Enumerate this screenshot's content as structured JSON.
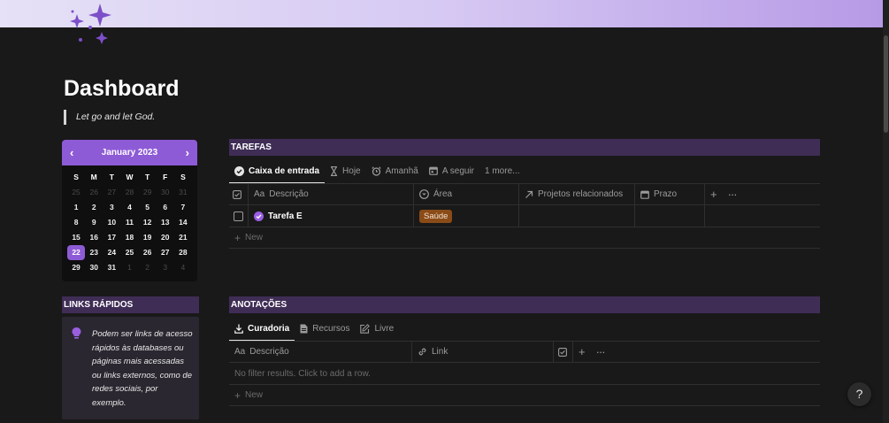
{
  "page": {
    "title": "Dashboard",
    "quote": "Let go and let God."
  },
  "calendar": {
    "month": "January 2023",
    "prev": "‹",
    "next": "›",
    "weekdays": [
      "S",
      "M",
      "T",
      "W",
      "T",
      "F",
      "S"
    ],
    "days": [
      [
        "25",
        "26",
        "27",
        "28",
        "29",
        "30",
        "31"
      ],
      [
        "1",
        "2",
        "3",
        "4",
        "5",
        "6",
        "7"
      ],
      [
        "8",
        "9",
        "10",
        "11",
        "12",
        "13",
        "14"
      ],
      [
        "15",
        "16",
        "17",
        "18",
        "19",
        "20",
        "21"
      ],
      [
        "22",
        "23",
        "24",
        "25",
        "26",
        "27",
        "28"
      ],
      [
        "29",
        "30",
        "31",
        "1",
        "2",
        "3",
        "4"
      ]
    ],
    "today": "22"
  },
  "links": {
    "title": "LINKS RÁPIDOS",
    "text": "Podem ser links de acesso rápidos às databases ou páginas mais acessadas ou links externos, como de redes sociais, por exemplo."
  },
  "tarefas": {
    "title": "TAREFAS",
    "tabs": [
      "Caixa de entrada",
      "Hoje",
      "Amanhã",
      "A seguir",
      "1 more..."
    ],
    "columns": [
      "Descrição",
      "Área",
      "Projetos relacionados",
      "Prazo"
    ],
    "rows": [
      {
        "name": "Tarefa E",
        "area": "Saúde"
      }
    ],
    "new": "New"
  },
  "anotacoes": {
    "title": "ANOTAÇÕES",
    "tabs": [
      "Curadoria",
      "Recursos",
      "Livre"
    ],
    "columns": [
      "Descrição",
      "Link"
    ],
    "empty": "No filter results. Click to add a row.",
    "new": "New"
  },
  "help": "?",
  "colors": {
    "accent": "#8e5bd6",
    "section": "#3f2d56",
    "badge": "#8a4b17"
  }
}
